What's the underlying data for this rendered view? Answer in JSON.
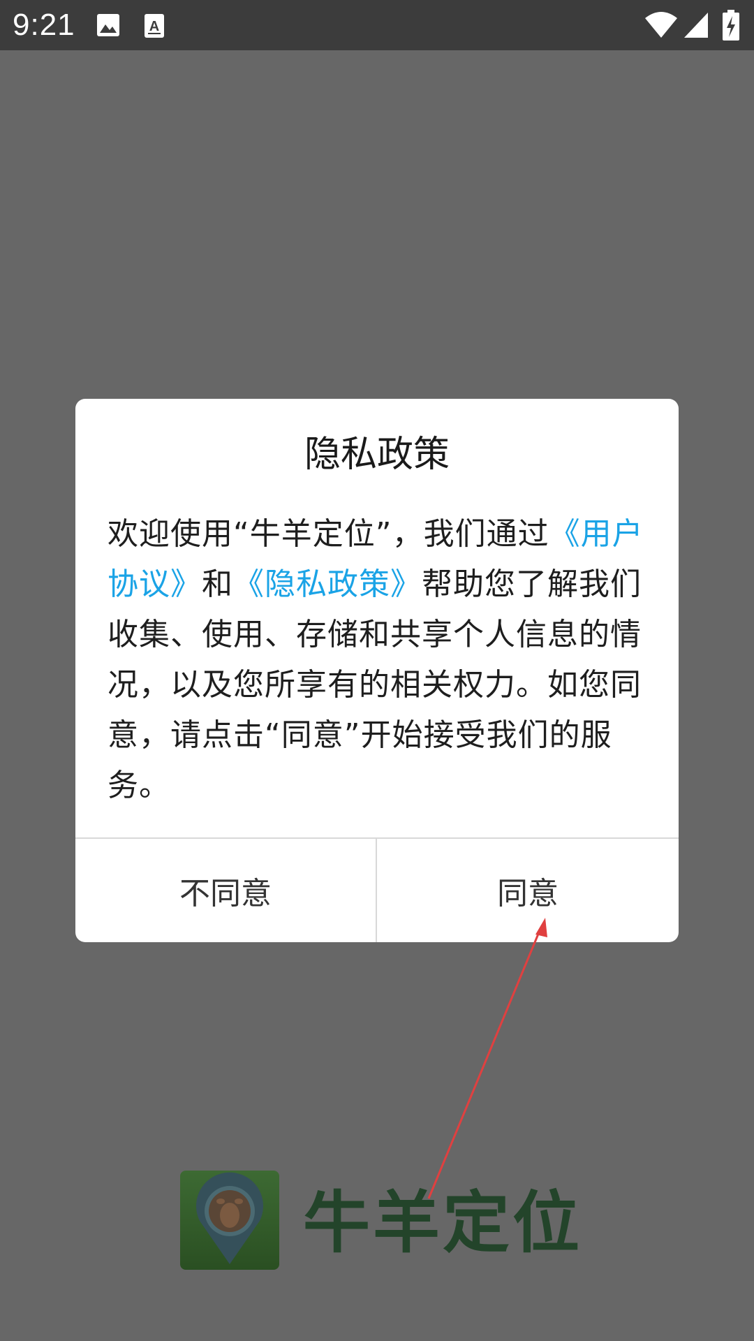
{
  "status_bar": {
    "time": "9:21",
    "icons": [
      "image-icon",
      "text-a-icon",
      "wifi-icon",
      "cell-signal-icon",
      "battery-charging-icon"
    ]
  },
  "brand": {
    "name": "牛羊定位",
    "colors": {
      "text": "#23442a"
    }
  },
  "dialog": {
    "title": "隐私政策",
    "body": {
      "part1": "欢迎使用“牛羊定位”，我们通过",
      "link_user_agreement": "《用户协议》",
      "part2": "和",
      "link_privacy_policy": "《隐私政策》",
      "part3": "帮助您了解我们收集、使用、存储和共享个人信息的情况，以及您所享有的相关权力。如您同意，请点击“同意”开始接受我们的服务。"
    },
    "buttons": {
      "disagree": "不同意",
      "agree": "同意"
    },
    "colors": {
      "link": "#1aa3e6",
      "overlay": "#676767"
    }
  },
  "annotation": {
    "type": "arrow",
    "color": "#e04040",
    "points_to": "agree-button"
  }
}
